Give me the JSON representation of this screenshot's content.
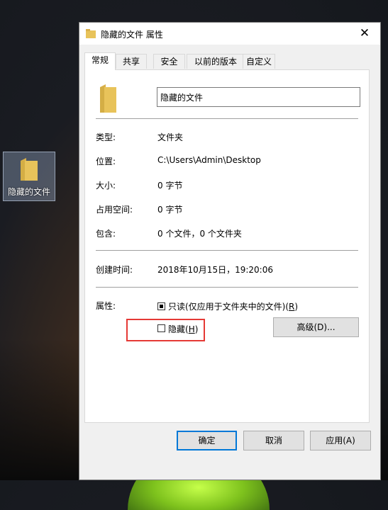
{
  "desktop": {
    "icon_label": "隐藏的文件",
    "folder_icon": "folder-icon"
  },
  "window": {
    "title": "隐藏的文件 属性",
    "close_label": "✕"
  },
  "tabs": [
    {
      "label": "常规",
      "active": true
    },
    {
      "label": "共享",
      "active": false
    },
    {
      "label": "安全",
      "active": false
    },
    {
      "label": "以前的版本",
      "active": false
    },
    {
      "label": "自定义",
      "active": false
    }
  ],
  "general": {
    "name_value": "隐藏的文件",
    "rows": [
      {
        "label": "类型:",
        "value": "文件夹"
      },
      {
        "label": "位置:",
        "value": "C:\\Users\\Admin\\Desktop"
      },
      {
        "label": "大小:",
        "value": "0 字节"
      },
      {
        "label": "占用空间:",
        "value": "0 字节"
      },
      {
        "label": "包含:",
        "value": "0 个文件，0 个文件夹"
      }
    ],
    "created_label": "创建时间:",
    "created_value": "2018年10月15日，19:20:06",
    "attributes_label": "属性:",
    "readonly": {
      "text": "只读(仅应用于文件夹中的文件)(",
      "key": "R",
      "end": ")",
      "state": "indeterminate"
    },
    "hidden": {
      "text": "隐藏(",
      "key": "H",
      "end": ")",
      "checked": false
    },
    "advanced_button": "高级(D)..."
  },
  "footer": {
    "ok": "确定",
    "cancel": "取消",
    "apply": "应用(A)"
  },
  "colors": {
    "folder": "#e8c35a",
    "highlight": "#e53935",
    "accent": "#0078d7"
  }
}
